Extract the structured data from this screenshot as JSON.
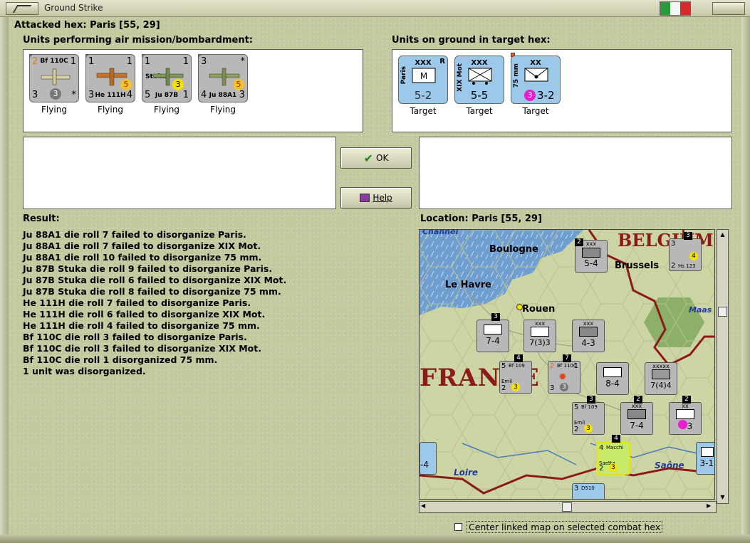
{
  "window": {
    "title": "Ground Strike",
    "flag_colors": [
      "#2a9a3a",
      "#f4f4f4",
      "#d42a2a"
    ]
  },
  "header": {
    "attacked_hex": "Attacked hex: Paris  [55, 29]"
  },
  "air_panel": {
    "label": "Units performing air mission/bombardment:",
    "units": [
      {
        "name": "Bf 110C",
        "tl": "2",
        "tr": "1",
        "bl": "3",
        "badge": "3",
        "br": "*",
        "status": "Flying"
      },
      {
        "name": "He 111H",
        "tl": "1",
        "tr": "1",
        "bl": "3",
        "badge": "5",
        "br": "4",
        "status": "Flying"
      },
      {
        "name": "Ju 87B",
        "tl": "1",
        "tr": "1",
        "bl": "5",
        "badge": "3",
        "br": "1",
        "status": "Flying",
        "sub": "Stuka"
      },
      {
        "name": "Ju 88A1",
        "tl": "3",
        "tr": "*",
        "bl": "4",
        "badge": "5",
        "br": "3",
        "status": "Flying"
      }
    ]
  },
  "ground_panel": {
    "label": "Units on ground in target hex:",
    "units": [
      {
        "side": "Paris",
        "size": "XXX",
        "flag": "R",
        "val": "5-2",
        "status": "Target"
      },
      {
        "side": "XIX Mot",
        "size": "XXX",
        "flag": "",
        "val": "5-5",
        "status": "Target"
      },
      {
        "side": "75 mm",
        "size": "XX",
        "flag": "",
        "val": "3-2",
        "badge": "3",
        "status": "Target"
      }
    ]
  },
  "buttons": {
    "ok": "OK",
    "help": "Help"
  },
  "result": {
    "label": "Result:",
    "lines": [
      "Ju 88A1 die roll 7 failed to disorganize Paris.",
      "Ju 88A1 die roll 7 failed to disorganize XIX Mot.",
      "Ju 88A1 die roll 10 failed to disorganize 75 mm.",
      "Ju 87B Stuka die roll 9 failed to disorganize Paris.",
      "Ju 87B Stuka die roll 6 failed to disorganize XIX Mot.",
      "Ju 87B Stuka die roll 8 failed to disorganize 75 mm.",
      "He 111H die roll 7 failed to disorganize Paris.",
      "He 111H die roll 6 failed to disorganize XIX Mot.",
      "He 111H die roll 4 failed to disorganize 75 mm.",
      "Bf 110C die roll 3 failed to disorganize Paris.",
      "Bf 110C die roll 3 failed to disorganize XIX Mot.",
      "Bf 110C die roll 1 disorganized 75 mm.",
      "1 unit was disorganized."
    ]
  },
  "location": {
    "label": "Location:  Paris  [55, 29]"
  },
  "map": {
    "places": [
      "BELGIUM",
      "Boulogne",
      "Brussels",
      "Le Havre",
      "Rouen",
      "FRANCE",
      "Loire",
      "Saône",
      "Maas",
      "Channel"
    ],
    "counters": [
      {
        "top": "xxx",
        "val": "5-4"
      },
      {
        "top": "xxx",
        "val": "7-4"
      },
      {
        "top": "xxx",
        "val": "7(3)3"
      },
      {
        "top": "xxx",
        "val": "4-3"
      },
      {
        "top": "xxx",
        "val": "8-4"
      },
      {
        "top": "xxxxx",
        "val": "7(4)4"
      },
      {
        "top": "xxx",
        "val": "7-4"
      },
      {
        "top": "xx",
        "val": "3"
      },
      {
        "top": "",
        "val": "3-1"
      },
      {
        "top": "",
        "val": "-4"
      }
    ],
    "air_counters": [
      {
        "name": "Bf 109",
        "sub": "Emil",
        "tl": "5",
        "bl": "2",
        "badge": "3"
      },
      {
        "name": "Bf 110C",
        "tl": "2",
        "tr": "1",
        "bl": "3",
        "badge": "3"
      },
      {
        "name": "Bf 109",
        "sub": "Emil",
        "tl": "5",
        "bl": "2",
        "badge": "3"
      },
      {
        "name": "Macchi",
        "sub": "Saetta",
        "tl": "4",
        "bl": "2",
        "badge": "3"
      },
      {
        "name": "Hs 123",
        "tl": "3",
        "bl": "2",
        "badge": "4"
      },
      {
        "name": "D510",
        "tl": "3",
        "bl": "",
        "badge": ""
      }
    ],
    "stack_numbers": [
      "2",
      "3",
      "3",
      "4",
      "7",
      "3",
      "2",
      "2",
      "4",
      "2"
    ],
    "colors": {
      "sea": "#6f9fd0",
      "land": "#cdd5a4",
      "forest": "#8cb068",
      "border": "#8c1a1a"
    }
  },
  "footer": {
    "checkbox_label": "Center linked map on selected combat hex"
  }
}
